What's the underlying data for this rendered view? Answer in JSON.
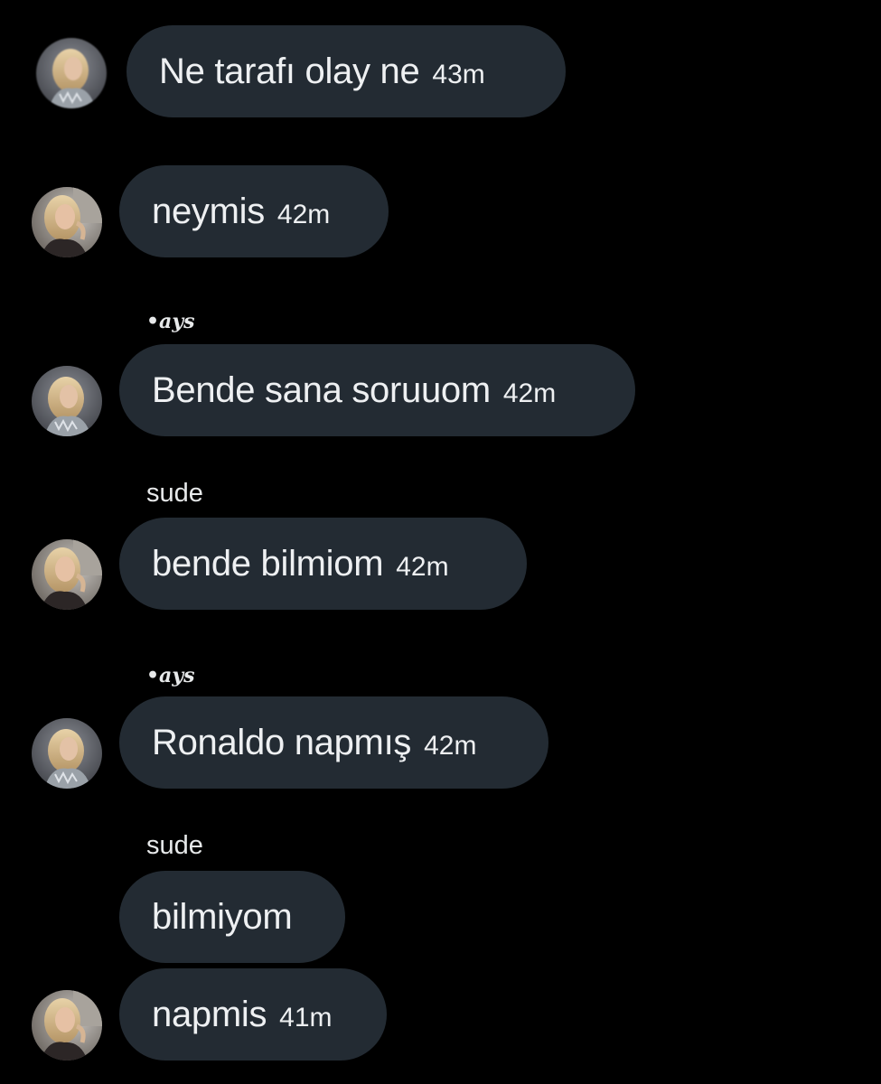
{
  "messages": [
    {
      "text": "Ne tarafı olay ne",
      "time": "43m",
      "avatar": "avatar-blonde-sparkle"
    },
    {
      "text": "neymis",
      "time": "42m",
      "avatar": "avatar-blonde-car"
    },
    {
      "sender": "•ays"
    },
    {
      "text": "Bende sana soruuom",
      "time": "42m",
      "avatar": "avatar-blonde-sparkle"
    },
    {
      "sender": "sude"
    },
    {
      "text": "bende bilmiom",
      "time": "42m",
      "avatar": "avatar-blonde-car"
    },
    {
      "sender": "•ays"
    },
    {
      "text": "Ronaldo napmış",
      "time": "42m",
      "avatar": "avatar-blonde-sparkle"
    },
    {
      "sender": "sude"
    },
    {
      "text": "bilmiyom",
      "time": ""
    },
    {
      "text": "napmis",
      "time": "41m",
      "avatar": "avatar-blonde-car"
    }
  ],
  "colors": {
    "background": "#000000",
    "bubble": "#232b33",
    "text": "#eef0f2"
  }
}
